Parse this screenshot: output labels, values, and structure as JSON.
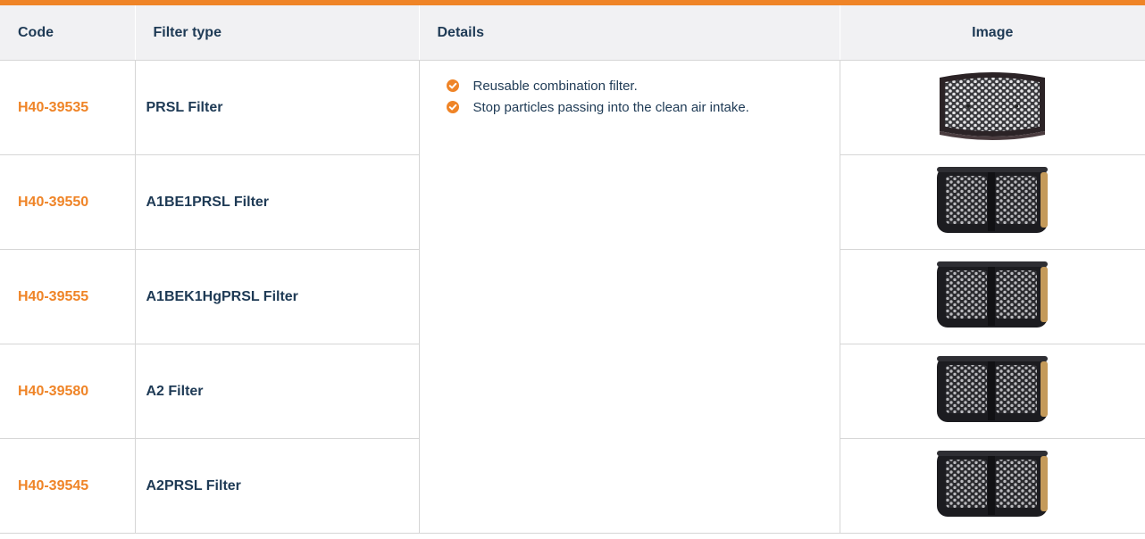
{
  "table": {
    "headers": {
      "code": "Code",
      "filter_type": "Filter type",
      "details": "Details",
      "image": "Image"
    },
    "details": [
      "Reusable combination filter.",
      "Stop particles passing into the clean air intake."
    ],
    "rows": [
      {
        "code": "H40-39535",
        "filter_type": "PRSL Filter",
        "image": "single-particle-filter-image"
      },
      {
        "code": "H40-39550",
        "filter_type": "A1BE1PRSL Filter",
        "image": "twin-combination-filter-image"
      },
      {
        "code": "H40-39555",
        "filter_type": "A1BEK1HgPRSL Filter",
        "image": "twin-combination-filter-image"
      },
      {
        "code": "H40-39580",
        "filter_type": "A2 Filter",
        "image": "twin-combination-filter-image"
      },
      {
        "code": "H40-39545",
        "filter_type": "A2PRSL Filter",
        "image": "twin-combination-filter-image"
      }
    ]
  },
  "colors": {
    "accent": "#ef8427",
    "text": "#1e3a55",
    "header_bg": "#f1f1f3",
    "border": "#d6d6d6"
  }
}
